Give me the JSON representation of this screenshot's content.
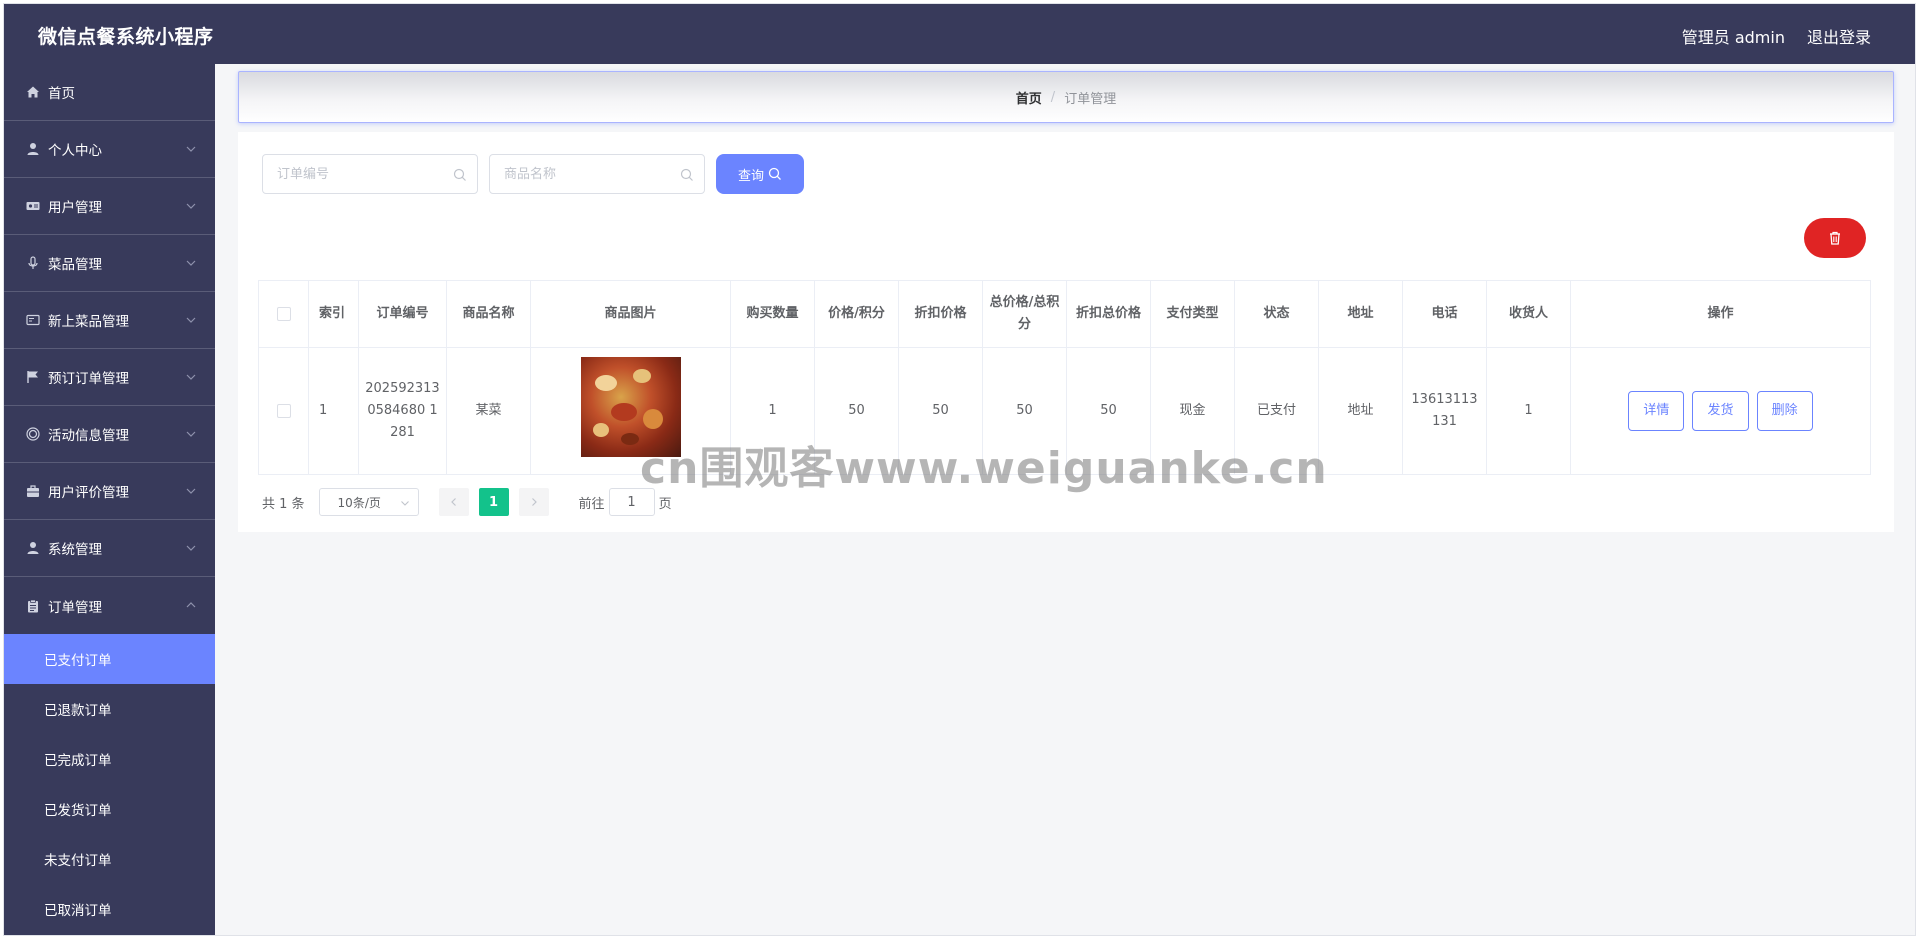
{
  "header": {
    "title": "微信点餐系统小程序",
    "admin_label": "管理员 admin",
    "logout_label": "退出登录"
  },
  "sidebar": {
    "items": [
      {
        "label": "首页",
        "icon": "home-icon",
        "expandable": false
      },
      {
        "label": "个人中心",
        "icon": "user-icon",
        "expandable": true
      },
      {
        "label": "用户管理",
        "icon": "ticket-icon",
        "expandable": true
      },
      {
        "label": "菜品管理",
        "icon": "microphone-icon",
        "expandable": true
      },
      {
        "label": "新上菜品管理",
        "icon": "card-icon",
        "expandable": true
      },
      {
        "label": "预订订单管理",
        "icon": "flag-icon",
        "expandable": true
      },
      {
        "label": "活动信息管理",
        "icon": "target-icon",
        "expandable": true
      },
      {
        "label": "用户评价管理",
        "icon": "briefcase-icon",
        "expandable": true
      },
      {
        "label": "系统管理",
        "icon": "user-icon",
        "expandable": true
      },
      {
        "label": "订单管理",
        "icon": "clipboard-icon",
        "expandable": true,
        "expanded": true
      }
    ],
    "submenu": [
      {
        "label": "已支付订单",
        "active": true
      },
      {
        "label": "已退款订单",
        "active": false
      },
      {
        "label": "已完成订单",
        "active": false
      },
      {
        "label": "已发货订单",
        "active": false
      },
      {
        "label": "未支付订单",
        "active": false
      },
      {
        "label": "已取消订单",
        "active": false
      }
    ]
  },
  "breadcrumb": {
    "home": "首页",
    "separator": "/",
    "current": "订单管理"
  },
  "search": {
    "order_no_placeholder": "订单编号",
    "product_name_placeholder": "商品名称",
    "query_label": "查询"
  },
  "table": {
    "headers": [
      "索引",
      "订单编号",
      "商品名称",
      "商品图片",
      "购买数量",
      "价格/积分",
      "折扣价格",
      "总价格/总积分",
      "折扣总价格",
      "支付类型",
      "状态",
      "地址",
      "电话",
      "收货人",
      "操作"
    ],
    "rows": [
      {
        "index": "1",
        "order_no": "2025923130584680 1281",
        "product_name": "某菜",
        "quantity": "1",
        "price": "50",
        "discount_price": "50",
        "total": "50",
        "discount_total": "50",
        "pay_type": "现金",
        "status": "已支付",
        "address": "地址",
        "phone": "13613113131",
        "receiver": "1",
        "actions": {
          "detail": "详情",
          "ship": "发货",
          "delete": "删除"
        }
      }
    ]
  },
  "pagination": {
    "total_text": "共 1 条",
    "page_size": "10条/页",
    "current_page": "1",
    "goto_label": "前往",
    "goto_value": "1",
    "page_suffix": "页"
  },
  "watermark": "cn围观客www.weiguanke.cn",
  "colors": {
    "sidebar_bg": "#383a5b",
    "accent": "#6b84ff",
    "danger": "#e02424",
    "page_active": "#13c28b"
  }
}
